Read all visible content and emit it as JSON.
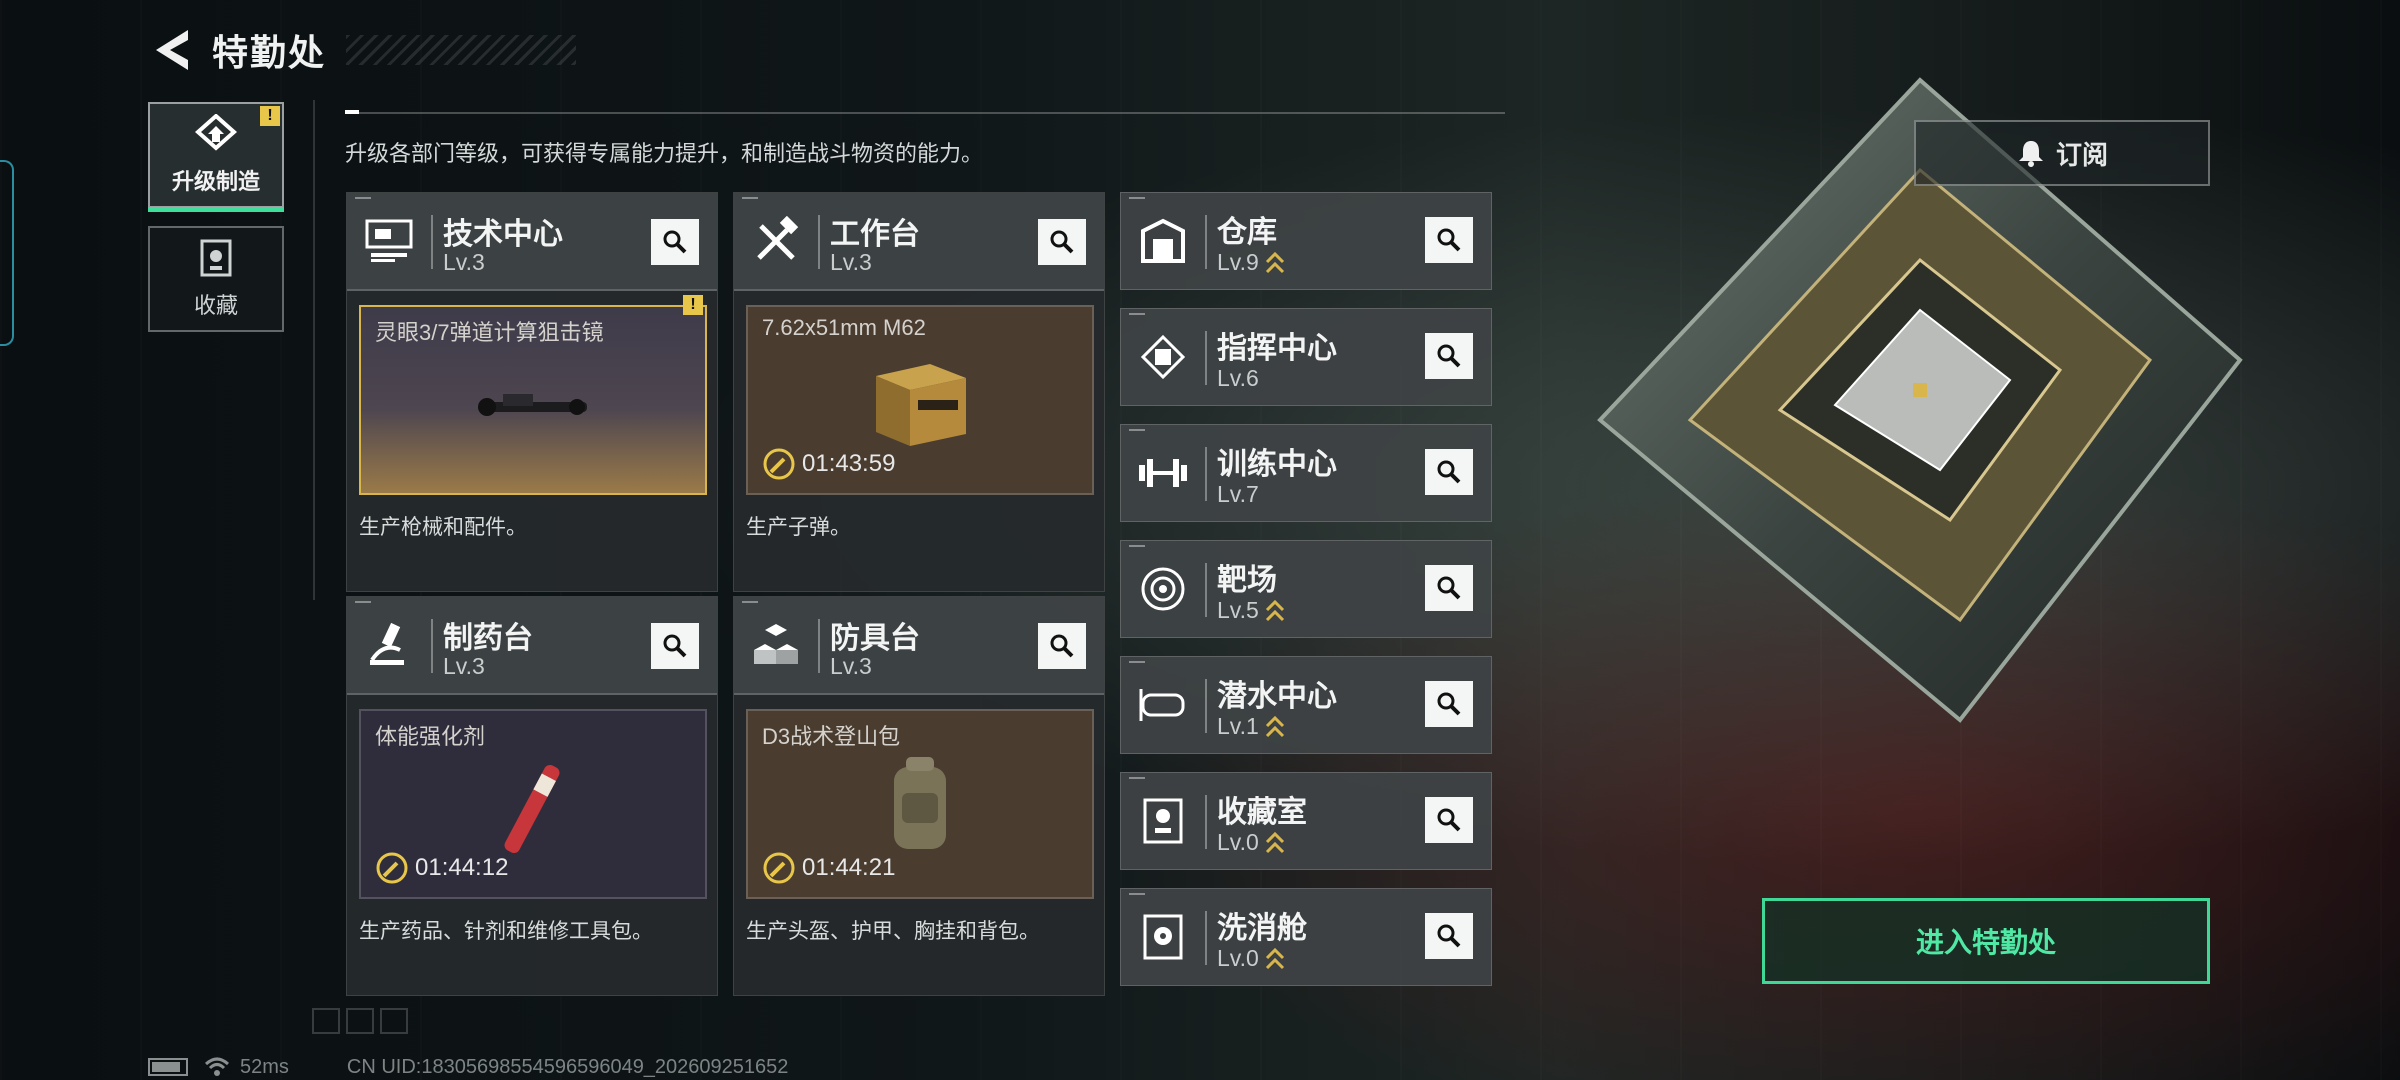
{
  "header": {
    "title": "特勤处"
  },
  "sidebar": {
    "items": [
      {
        "label": "升级制造",
        "active": true,
        "badge": "!"
      },
      {
        "label": "收藏",
        "active": false
      }
    ]
  },
  "description": "升级各部门等级，可获得专属能力提升，和制造战斗物资的能力。",
  "subscribe": {
    "label": "订阅"
  },
  "production_cards": [
    {
      "name": "技术中心",
      "level": "Lv.3",
      "product": "灵眼3/7弹道计算狙击镜",
      "timer": "",
      "desc": "生产枪械和配件。",
      "badge": "!"
    },
    {
      "name": "工作台",
      "level": "Lv.3",
      "product": "7.62x51mm M62",
      "timer": "01:43:59",
      "desc": "生产子弹。"
    },
    {
      "name": "制药台",
      "level": "Lv.3",
      "product": "体能强化剂",
      "timer": "01:44:12",
      "desc": "生产药品、针剂和维修工具包。"
    },
    {
      "name": "防具台",
      "level": "Lv.3",
      "product": "D3战术登山包",
      "timer": "01:44:21",
      "desc": "生产头盔、护甲、胸挂和背包。"
    }
  ],
  "facility_cards": [
    {
      "name": "仓库",
      "level": "Lv.9",
      "upgrade": true
    },
    {
      "name": "指挥中心",
      "level": "Lv.6",
      "upgrade": false
    },
    {
      "name": "训练中心",
      "level": "Lv.7",
      "upgrade": false
    },
    {
      "name": "靶场",
      "level": "Lv.5",
      "upgrade": true
    },
    {
      "name": "潜水中心",
      "level": "Lv.1",
      "upgrade": true
    },
    {
      "name": "收藏室",
      "level": "Lv.0",
      "upgrade": true
    },
    {
      "name": "洗消舱",
      "level": "Lv.0",
      "upgrade": true
    }
  ],
  "enter_button": {
    "label": "进入特勤处"
  },
  "status_bar": {
    "ping": "52ms",
    "uid": "CN UID:18305698554596596049_202609251652"
  },
  "colors": {
    "accent": "#3fd896",
    "warning": "#e8c64a",
    "upgrade": "#d8b64c"
  }
}
